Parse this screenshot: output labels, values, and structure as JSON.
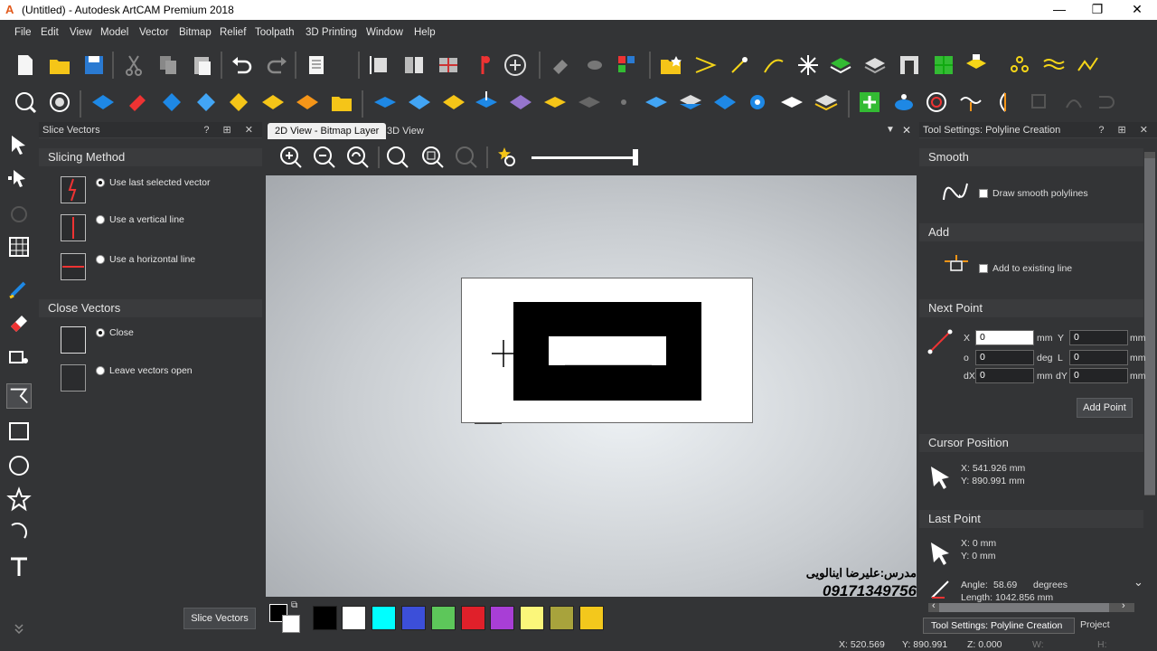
{
  "window": {
    "title": "(Untitled) - Autodesk ArtCAM Premium 2018",
    "logo_icon": "artcam-logo-icon"
  },
  "menu": [
    "File",
    "Edit",
    "View",
    "Model",
    "Vector",
    "Bitmap",
    "Relief",
    "Toolpath",
    "3D Printing",
    "Window",
    "Help"
  ],
  "left_panel": {
    "title": "Slice Vectors",
    "slicing_method": {
      "heading": "Slicing Method",
      "options": [
        {
          "label": "Use last selected vector",
          "selected": true
        },
        {
          "label": "Use a vertical line",
          "selected": false
        },
        {
          "label": "Use a horizontal line",
          "selected": false
        }
      ]
    },
    "close_vectors": {
      "heading": "Close Vectors",
      "options": [
        {
          "label": "Close",
          "selected": true
        },
        {
          "label": "Leave vectors open",
          "selected": false
        }
      ]
    },
    "action_button": "Slice Vectors"
  },
  "view": {
    "tabs": [
      "2D View - Bitmap Layer",
      "3D View"
    ],
    "active_tab": "2D View - Bitmap Layer"
  },
  "watermark": {
    "line1": "مدرس:علیرضا اینالویی",
    "line2": "09171349756"
  },
  "palette": {
    "colors": [
      "#000000",
      "#ffffff",
      "#00ffff",
      "#3c4fd9",
      "#5dc75a",
      "#e0202a",
      "#a83ed6",
      "#fbf67a",
      "#a8a33c",
      "#f3c81c"
    ]
  },
  "right_panel": {
    "title": "Tool Settings: Polyline Creation",
    "smooth": {
      "heading": "Smooth",
      "checkbox": "Draw smooth polylines"
    },
    "add": {
      "heading": "Add",
      "checkbox": "Add to existing line"
    },
    "next_point": {
      "heading": "Next Point",
      "fields": [
        {
          "label": "X",
          "value": "0",
          "unit": "mm",
          "label2": "Y",
          "value2": "0",
          "unit2": "mm"
        },
        {
          "label": "o",
          "value": "0",
          "unit": "deg",
          "label2": "L",
          "value2": "0",
          "unit2": "mm"
        },
        {
          "label": "dX",
          "value": "0",
          "unit": "mm",
          "label2": "dY",
          "value2": "0",
          "unit2": "mm"
        }
      ],
      "button": "Add Point"
    },
    "cursor_position": {
      "heading": "Cursor Position",
      "x": "X: 541.926 mm",
      "y": "Y: 890.991 mm"
    },
    "last_point": {
      "heading": "Last Point",
      "x": "X: 0 mm",
      "y": "Y: 0 mm"
    },
    "angle": {
      "label": "Angle:",
      "value": "58.69",
      "unit": "degrees",
      "length": "Length: 1042.856 mm"
    },
    "bottom_tabs": [
      "Tool Settings: Polyline Creation",
      "Project"
    ]
  },
  "status": {
    "x": "X: 520.569",
    "y": "Y: 890.991",
    "z": "Z: 0.000",
    "w": "W:",
    "h": "H:"
  },
  "colors": {
    "accent_blue": "#1e88e5",
    "panel_bg": "#333436",
    "section_bg": "#3a3b3d"
  }
}
